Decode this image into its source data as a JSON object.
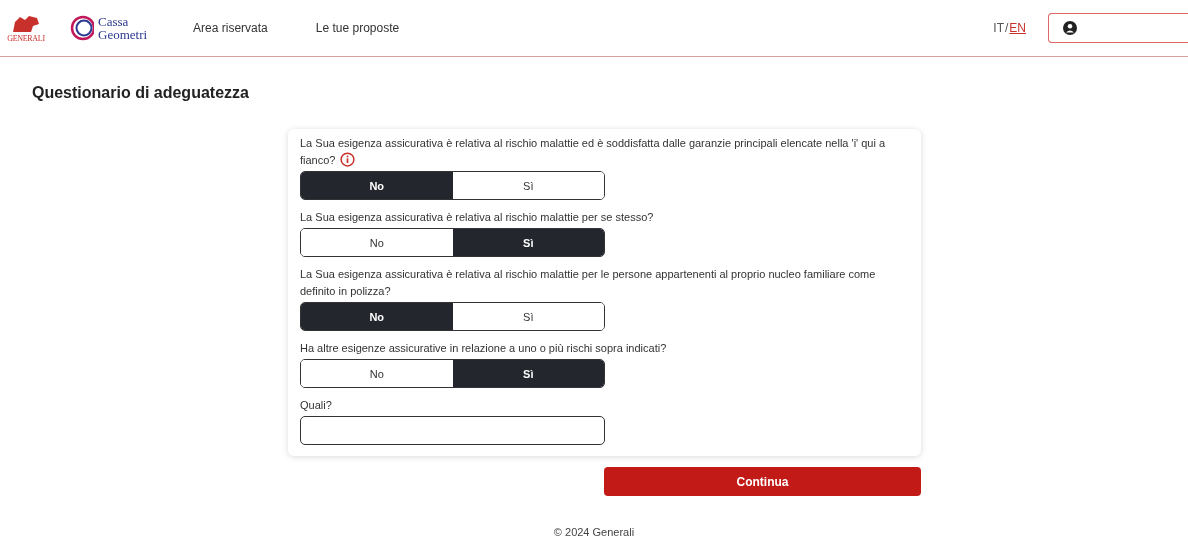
{
  "header": {
    "brand": "GENERALI",
    "partner": [
      "Cassa",
      "Geometri"
    ],
    "nav": [
      "Area riservata",
      "Le tue proposte"
    ],
    "languages": [
      {
        "label": "IT",
        "selected": false
      },
      {
        "label": "EN",
        "selected": true
      }
    ],
    "separator": "/"
  },
  "page_title": "Questionario di adeguatezza",
  "questions": [
    {
      "kind": "choice",
      "text": "La Sua esigenza assicurativa è relativa al rischio malattie ed è soddisfatta dalle garanzie principali elencate nella 'i' qui a fianco?",
      "info": true,
      "options": [
        {
          "label": "No",
          "selected": true
        },
        {
          "label": "Sì",
          "selected": false
        }
      ]
    },
    {
      "kind": "choice",
      "text": "La Sua esigenza assicurativa è relativa al rischio malattie per se stesso?",
      "info": false,
      "options": [
        {
          "label": "No",
          "selected": false
        },
        {
          "label": "Sì",
          "selected": true
        }
      ]
    },
    {
      "kind": "choice",
      "text": "La Sua esigenza assicurativa è relativa al rischio malattie per le persone appartenenti al proprio nucleo familiare come definito in polizza?",
      "info": false,
      "options": [
        {
          "label": "No",
          "selected": true
        },
        {
          "label": "Sì",
          "selected": false
        }
      ]
    },
    {
      "kind": "choice",
      "text": "Ha altre esigenze assicurative in relazione a uno o più rischi sopra indicati?",
      "info": false,
      "options": [
        {
          "label": "No",
          "selected": false
        },
        {
          "label": "Sì",
          "selected": true
        }
      ]
    },
    {
      "kind": "text",
      "text": "Quali?"
    }
  ],
  "continue_button": "Continua",
  "footer": "© 2024 Generali"
}
